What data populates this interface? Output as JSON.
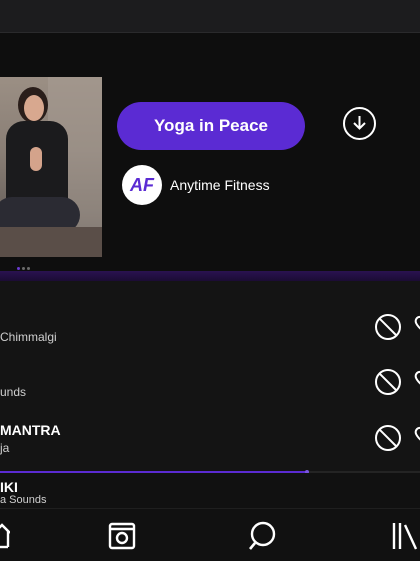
{
  "hero": {
    "title": "Yoga in Peace",
    "studio_logo_text": "AF",
    "studio_name": "Anytime Fitness",
    "pager": {
      "count": 3,
      "active": 1
    }
  },
  "tracks": [
    {
      "title": "",
      "subtitle": "Chimmalgi"
    },
    {
      "title": "",
      "subtitle": "unds"
    },
    {
      "title": "MANTRA",
      "subtitle": "ja"
    }
  ],
  "now_playing": {
    "title": "IKI",
    "subtitle": "a Sounds",
    "progress": 0.73
  },
  "colors": {
    "accent": "#5b2bd3",
    "background": "#1a1a1c"
  },
  "icons": {
    "download": "download-circle-icon",
    "block": "block-icon",
    "like": "heart-icon",
    "tabs": [
      "home-icon",
      "library-box-icon",
      "search-icon",
      "collection-icon"
    ]
  }
}
